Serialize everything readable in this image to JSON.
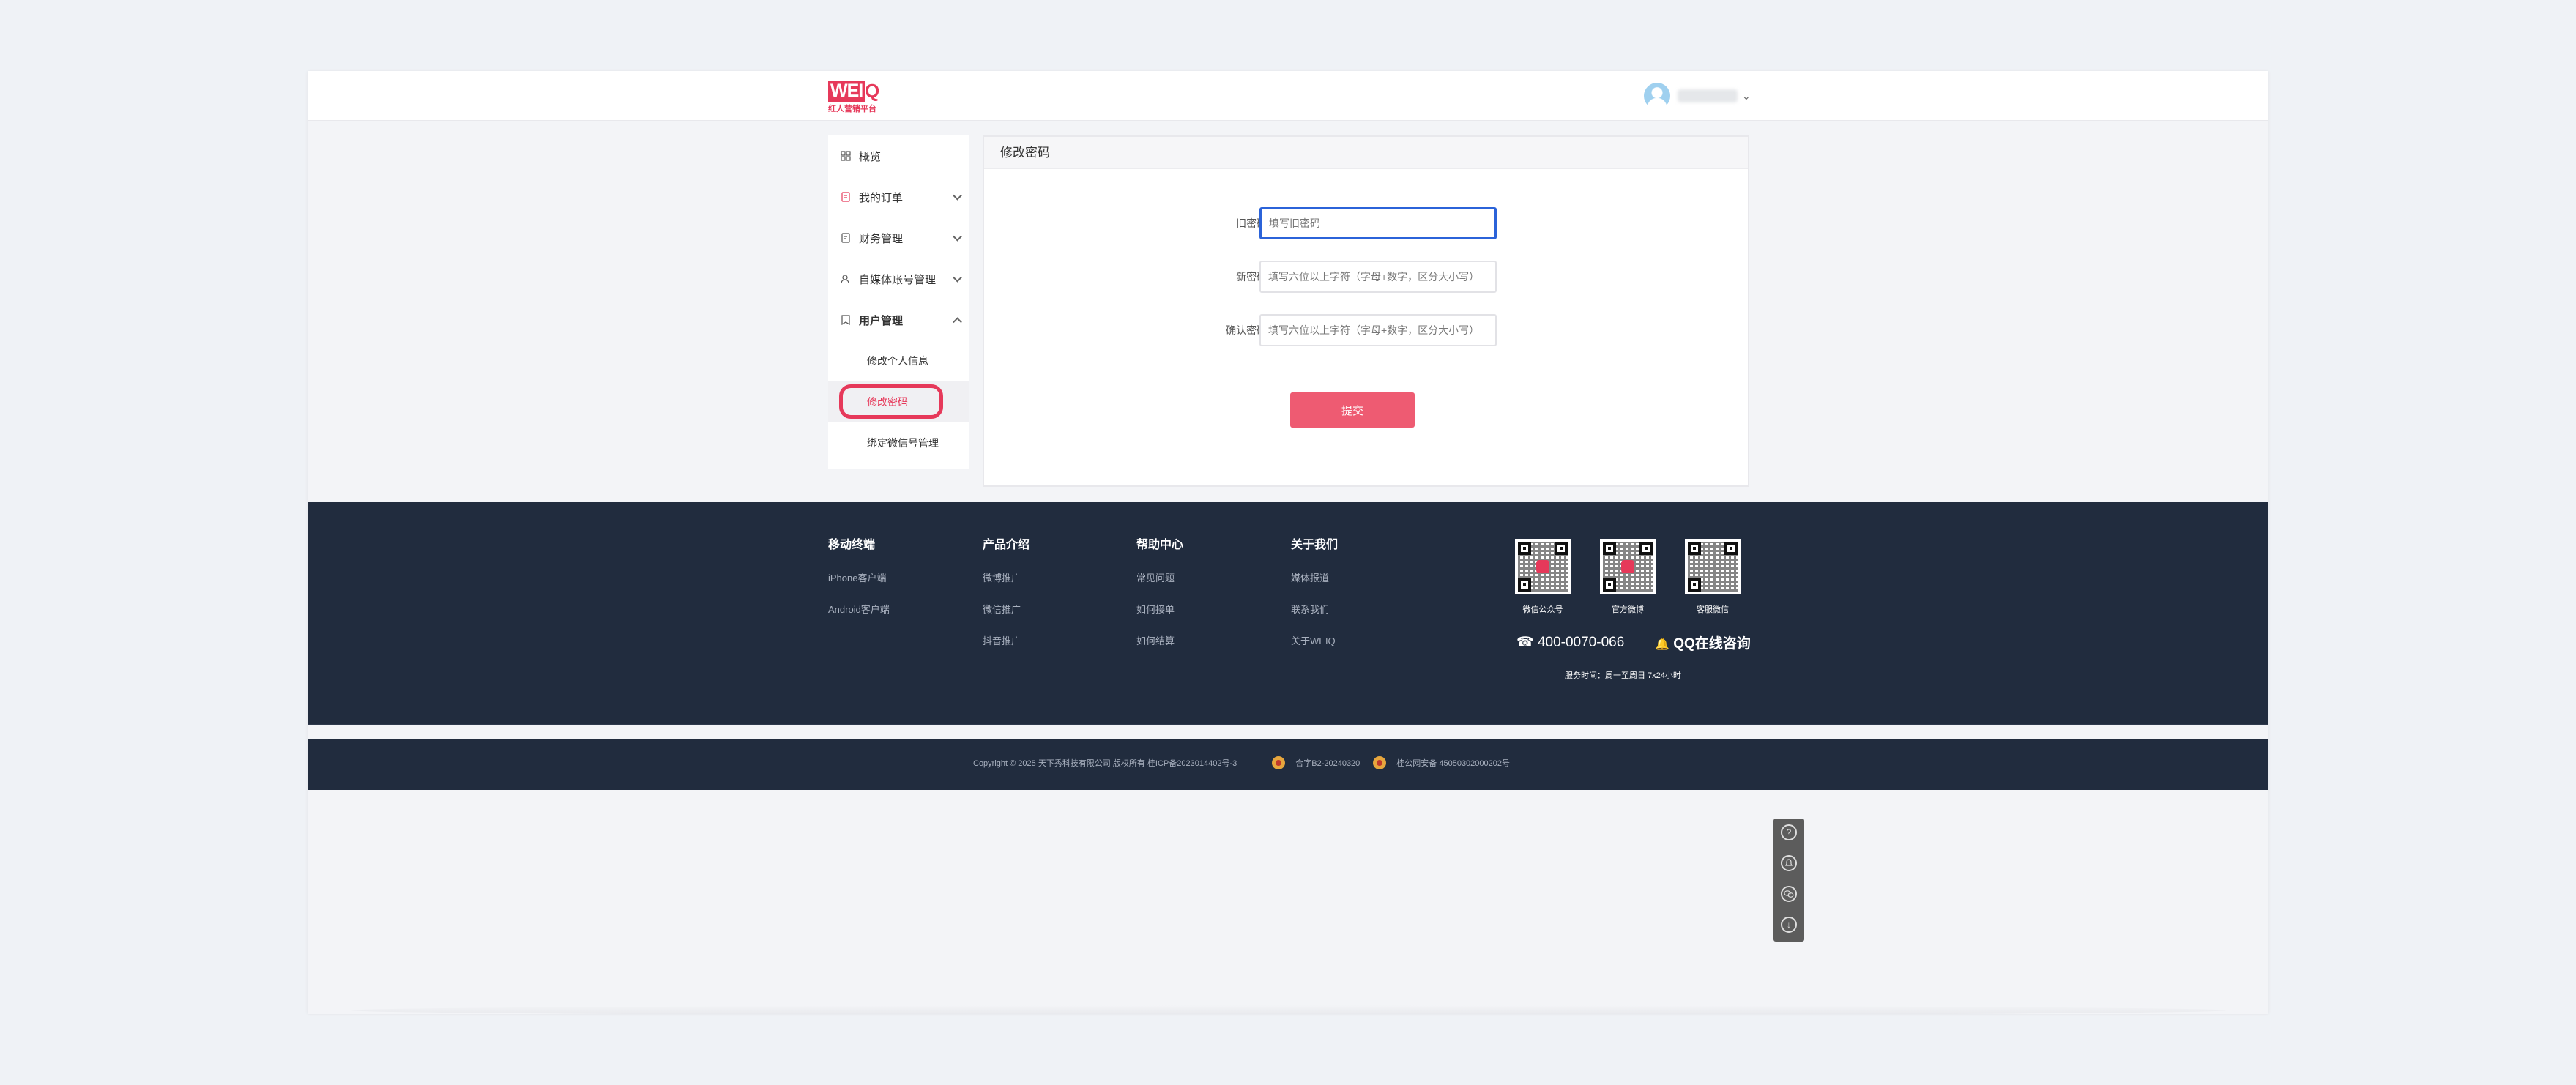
{
  "header": {
    "logo_main": "WEI",
    "logo_q": "Q",
    "logo_sub": "红人营销平台",
    "username": ""
  },
  "sidebar": {
    "items": [
      {
        "label": "概览",
        "icon": "grid-icon"
      },
      {
        "label": "我的订单",
        "icon": "order-icon"
      },
      {
        "label": "财务管理",
        "icon": "finance-icon"
      },
      {
        "label": "自媒体账号管理",
        "icon": "account-icon"
      },
      {
        "label": "用户管理",
        "icon": "user-icon"
      }
    ],
    "sub_items": [
      {
        "label": "修改个人信息"
      },
      {
        "label": "修改密码"
      },
      {
        "label": "绑定微信号管理"
      }
    ]
  },
  "panel": {
    "title": "修改密码",
    "fields": [
      {
        "label": "旧密码:",
        "placeholder": "填写旧密码"
      },
      {
        "label": "新密码:",
        "placeholder": "填写六位以上字符（字母+数字，区分大小写）"
      },
      {
        "label": "确认密码:",
        "placeholder": "填写六位以上字符（字母+数字，区分大小写）"
      }
    ],
    "submit_label": "提交"
  },
  "footer": {
    "columns": [
      {
        "title": "移动终端",
        "links": [
          "iPhone客户端",
          "Android客户端"
        ]
      },
      {
        "title": "产品介绍",
        "links": [
          "微博推广",
          "微信推广",
          "抖音推广"
        ]
      },
      {
        "title": "帮助中心",
        "links": [
          "常见问题",
          "如何接单",
          "如何结算"
        ]
      },
      {
        "title": "关于我们",
        "links": [
          "媒体报道",
          "联系我们",
          "关于WEIQ"
        ]
      }
    ],
    "qr_codes": [
      "微信公众号",
      "官方微博",
      "客服微信"
    ],
    "hotline": "☎ 400-0070-066",
    "qq": "QQ在线咨询",
    "service_time": "服务时间：周一至周日 7x24小时",
    "copyright": "Copyright © 2025 天下秀科技有限公司 版权所有 桂ICP备2023014402号-3",
    "license1": "合字B2-20240320",
    "license2": "桂公网安备 45050302000202号"
  },
  "float_toolbar": {
    "icons": [
      "help-icon",
      "qq-icon",
      "wechat-icon",
      "download-icon"
    ]
  },
  "colors": {
    "brand": "#e6395a",
    "footer_bg": "#212c3e",
    "submit_bg": "#ee5b72",
    "focus_border": "#2b63d9"
  }
}
